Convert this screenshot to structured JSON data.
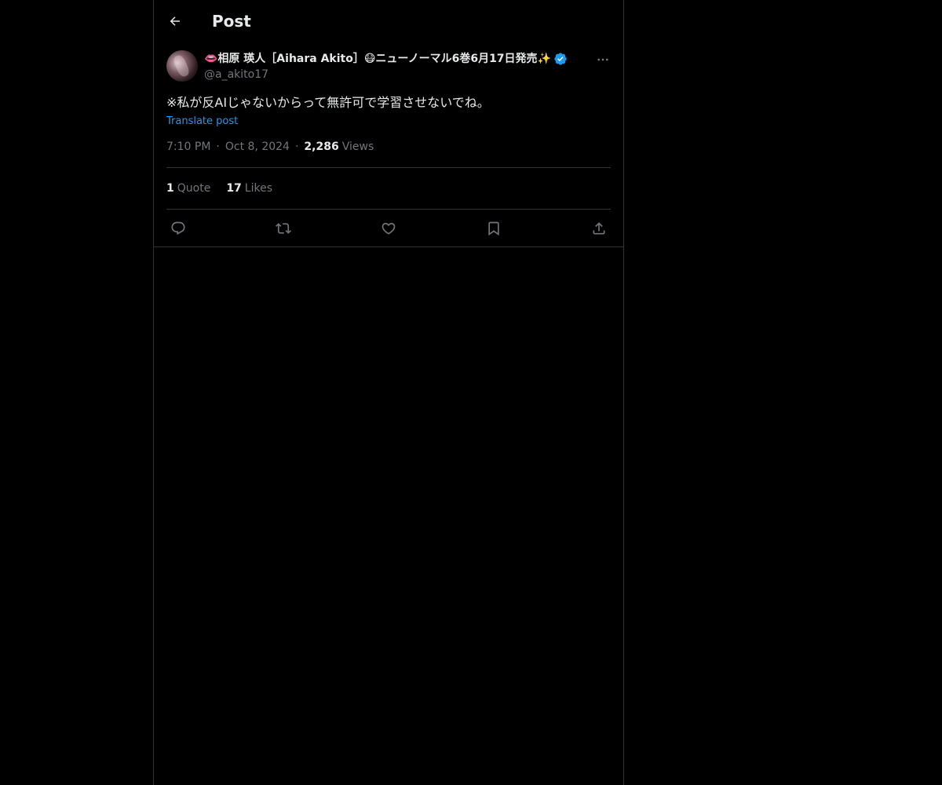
{
  "header": {
    "title": "Post",
    "back_icon": "arrow-left-icon"
  },
  "post": {
    "author": {
      "display_name": "👄相原 瑛人［Aihara Akito］😷ニューノーマル6巻6月17日発売✨",
      "handle": "@a_akito17",
      "verified": true
    },
    "text": "※私が反AIじゃないからって無許可で学習させないでね。",
    "translate_label": "Translate post",
    "time": "7:10 PM",
    "date": "Oct 8, 2024",
    "views_count": "2,286",
    "views_label": "Views",
    "stats": {
      "quotes_count": "1",
      "quotes_label": "Quote",
      "likes_count": "17",
      "likes_label": "Likes"
    },
    "actions": [
      "reply-icon",
      "repost-icon",
      "like-icon",
      "bookmark-icon",
      "share-icon"
    ]
  },
  "colors": {
    "background": "#000000",
    "text_primary": "#e7e9ea",
    "text_secondary": "#71767b",
    "border": "#2f3336",
    "accent": "#1d9bf0"
  }
}
